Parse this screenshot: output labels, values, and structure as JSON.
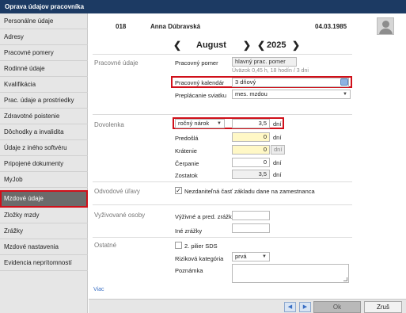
{
  "window": {
    "title": "Oprava údajov pracovníka"
  },
  "sidebar": {
    "items": [
      {
        "label": "Personálne údaje"
      },
      {
        "label": "Adresy"
      },
      {
        "label": "Pracovné pomery"
      },
      {
        "label": "Rodinné údaje"
      },
      {
        "label": "Kvalifikácia"
      },
      {
        "label": "Prac. údaje a prostriedky"
      },
      {
        "label": "Zdravotné poistenie"
      },
      {
        "label": "Dôchodky a invalidita"
      },
      {
        "label": "Údaje z iného softvéru"
      },
      {
        "label": "Pripojené dokumenty"
      },
      {
        "label": "MyJob"
      },
      {
        "label": "Mzdové údaje"
      },
      {
        "label": "Zložky mzdy"
      },
      {
        "label": "Zrážky"
      },
      {
        "label": "Mzdové nastavenia"
      },
      {
        "label": "Evidencia neprítomností"
      }
    ],
    "active": "Mzdové údaje"
  },
  "header": {
    "employee_id": "018",
    "employee_name": "Anna Dúbravská",
    "birth_date": "04.03.1985",
    "month": "August",
    "year": "2025",
    "prev_symbol": "❮",
    "next_symbol": "❯"
  },
  "pracovne_udaje": {
    "title": "Pracovné údaje",
    "pomer_label": "Pracovný pomer",
    "pomer_value": "hlavný prac. pomer",
    "uvazok_hint": "Úväzok 0,45 h, 18 hodín  / 3 dni",
    "kalendar_label": "Pracovný kalendár",
    "kalendar_value": "3 dňový",
    "preplacanie_label": "Preplácanie sviatku",
    "preplacanie_value": "mes. mzdou"
  },
  "dovolenka": {
    "title": "Dovolenka",
    "narok_select": "ročný nárok",
    "narok_value": "3,5",
    "predosla_label": "Predošlá",
    "predosla_value": "0",
    "kratenie_label": "Krátenie",
    "kratenie_value": "0",
    "cerpanie_label": "Čerpanie",
    "cerpanie_value": "0",
    "zostatok_label": "Zostatok",
    "zostatok_value": "3,5",
    "unit": "dní"
  },
  "odvodove": {
    "title": "Odvodové úľavy",
    "checkbox_label": "Nezdaniteľná časť základu dane na zamestnanca",
    "checked": true,
    "check_glyph": "✓"
  },
  "vyzivovane": {
    "title": "Vyživované osoby",
    "vyzivne_label": "Výživné a pred. zrážky",
    "ine_label": "Iné zrážky"
  },
  "ostatne": {
    "title": "Ostatné",
    "pilier_label": "2. pilier SDS",
    "rizikova_label": "Riziková kategória",
    "rizikova_value": "prvá",
    "poznamka_label": "Poznámka"
  },
  "viac_link": "Viac",
  "footer": {
    "prev_symbol": "◀",
    "next_symbol": "▶",
    "ok_label": "Ok",
    "cancel_label": "Zruš"
  },
  "colors": {
    "titlebar": "#1c3a63",
    "highlight_red": "#d0101a",
    "yellow_field": "#fff8c6",
    "active_sidebar": "#6b6b6b"
  }
}
